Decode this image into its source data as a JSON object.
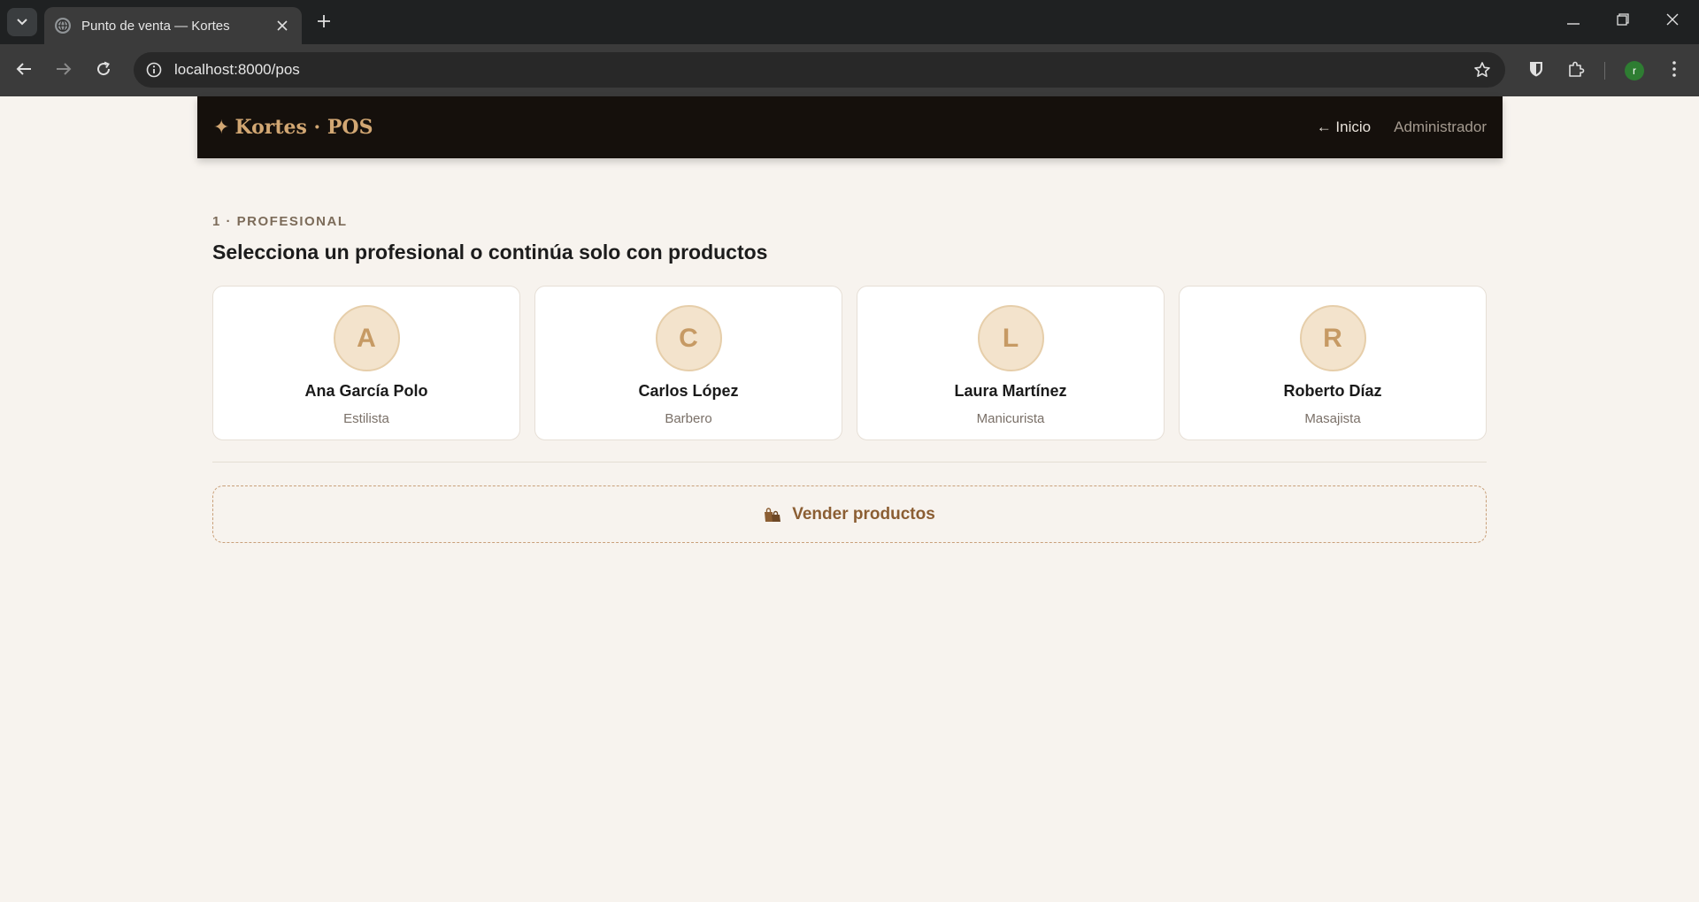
{
  "browser": {
    "tab_title": "Punto de venta — Kortes",
    "url": "localhost:8000/pos",
    "profile_initial": "r"
  },
  "header": {
    "brand_icon": "✦",
    "brand_name": "Kortes · POS",
    "nav_home": "← Inicio",
    "nav_admin": "Administrador"
  },
  "section": {
    "step": "1 · PROFESIONAL",
    "title": "Selecciona un profesional o continúa solo con productos"
  },
  "professionals": [
    {
      "initial": "A",
      "name": "Ana García Polo",
      "role": "Estilista"
    },
    {
      "initial": "C",
      "name": "Carlos López",
      "role": "Barbero"
    },
    {
      "initial": "L",
      "name": "Laura Martínez",
      "role": "Manicurista"
    },
    {
      "initial": "R",
      "name": "Roberto Díaz",
      "role": "Masajista"
    }
  ],
  "sell_products": {
    "icon": "shopping-bags-icon",
    "label": "Vender productos"
  },
  "colors": {
    "header_bg": "#15100c",
    "accent_gold": "#d2a773",
    "page_bg": "#f7f3ee",
    "sell_text": "#8b5e33",
    "avatar_bg": "#f3e3cc"
  }
}
